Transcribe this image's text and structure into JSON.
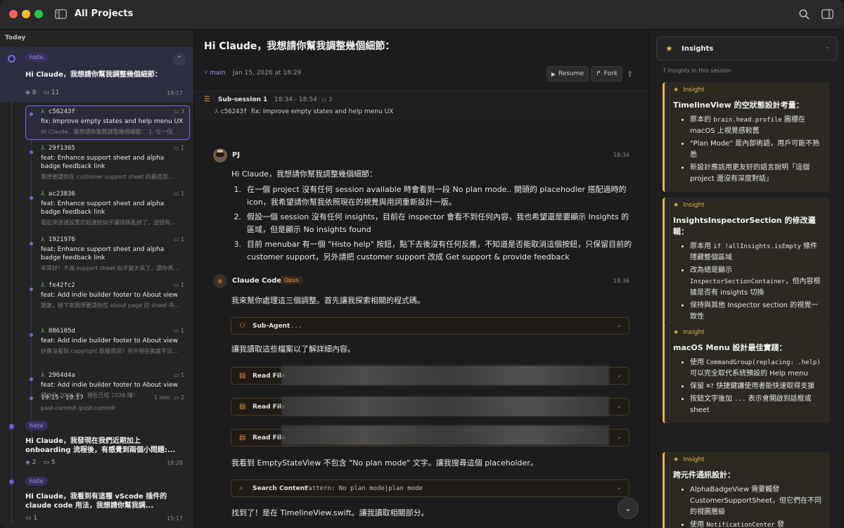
{
  "window": {
    "title": "All Projects"
  },
  "sidebar": {
    "section": "Today",
    "sessions": [
      {
        "tag": "histo",
        "title": "Hi Claude，我想請你幫我調整幾個細節：",
        "layers": "8",
        "comments": "11",
        "time": "19:17"
      },
      {
        "tag": "histo",
        "title": "Hi Claude，我發現在我們近期加上 onboarding 流程後，有感覺到兩個小問題:...",
        "layers": "2",
        "comments": "5",
        "time": "18:28"
      },
      {
        "tag": "histo",
        "title": "Hi Claude，我看到有這種 vScode 插件的 claude code 用法，我想請你幫我調...",
        "comments": "1",
        "time": "15:17"
      }
    ],
    "commits": [
      {
        "hash": "c56243f",
        "count": "3",
        "message": "fix: Improve empty states and help menu UX",
        "preview": "Hi Claude，我想請你幫我調整幾個細節： 1. 在一個..."
      },
      {
        "hash": "29f1365",
        "count": "1",
        "message": "feat: Enhance support sheet and alpha badge feedback link",
        "preview": "我想要請你在 customer support sheet 的最底部..."
      },
      {
        "hash": "ac23836",
        "count": "1",
        "message": "feat: Enhance support sheet and alpha badge feedback link",
        "preview": "看起來這邊設置的超連結似乎讓排版亂掉了，這個有..."
      },
      {
        "hash": "1921976",
        "count": "1",
        "message": "feat: Enhance support sheet and alpha badge feedback link",
        "preview": "非常好！不過 support sheet 似乎變太長了，請你再..."
      },
      {
        "hash": "fe42fc2",
        "count": "1",
        "message": "feat: Add indie builder footer to About view",
        "preview": "謝謝，接下來我想要請你在 about page 的 sheet 中..."
      },
      {
        "hash": "086105d",
        "count": "1",
        "message": "feat: Add indie builder footer to About view",
        "preview": "好像沒看到 copyright 版權資訊？另外現在高度不足..."
      },
      {
        "hash": "2964d4a",
        "count": "1",
        "message": "feat: Add indie builder footer to About view",
        "preview": "請改為 2026 年，現在已經 2026 囉！"
      }
    ],
    "post_commit": {
      "range": "19:15 - 19:17",
      "duration": "1 min",
      "count": "2",
      "label": "post-commit /post-commit"
    }
  },
  "main": {
    "title": "Hi Claude，我想請你幫我調整幾個細節：",
    "branch": "main",
    "date": "Jan 15, 2026 at 18:29",
    "resume_label": "Resume",
    "fork_label": "Fork",
    "subsession": {
      "label": "Sub-session 1",
      "range": "18:34 - 18:54",
      "count": "3",
      "hash": "c56243f",
      "message": "fix: Improve empty states and help menu UX"
    },
    "user": {
      "name": "PJ",
      "time": "18:34",
      "intro": "Hi Claude，我想請你幫我調整幾個細節：",
      "items": [
        {
          "num": "1.",
          "text": "在一個 project 沒有任何 session available 時會看到一段 No plan mode.. 開頭的 placehodler 搭配過時的 icon，我希望請你幫我依照現在的視覺與用詞重新設計一版。"
        },
        {
          "num": "2.",
          "text": "假設一個 session 沒有任何 insights，目前在 inspector 會看不到任何內容，我也希望還是要顯示 Insights 的區域，但是顯示 No insights found"
        },
        {
          "num": "3.",
          "text": "目前 menubar 有一個 \"Histo help\" 按鈕，點下去後沒有任何反應，不知道是否能取消這個按鈕，只保留目前的 customer support，另外請把 customer support 改成 Get support & provide feedback"
        }
      ]
    },
    "assistant": {
      "name": "Claude Code",
      "badge": "Opus",
      "time": "18:36",
      "line1": "我來幫你處理這三個調整。首先讓我探索相關的程式碼。",
      "subagent_label": "Sub-Agent",
      "subagent_value": "...",
      "line2": "讓我讀取這些檔案以了解詳細內容。",
      "read_label": "Read File",
      "line3": "我看到 EmptyStateView 不包含 \"No plan mode\" 文字。讓我搜尋這個 placeholder。",
      "search_label": "Search Content",
      "search_pattern": "Pattern: No plan mode|plan mode",
      "line4": "找到了！是在 TimelineView.swift。讓我讀取相關部分。"
    }
  },
  "inspector": {
    "title": "Insights",
    "summary": "7 insights in this session",
    "header_label": "Insight",
    "cards": [
      {
        "title": "TimelineView 的空狀態設計考量：",
        "bullets": [
          {
            "pre": "原本的 ",
            "code": "brain.head.profile",
            "post": " 圖標在 macOS 上視覺感較舊"
          },
          {
            "pre": "\"Plan Mode\" 是內部術語，用戶可能不熟悉",
            "code": "",
            "post": ""
          },
          {
            "pre": "新設計應該用更友好的語言說明「這個 project 還沒有深度對話」",
            "code": "",
            "post": ""
          }
        ]
      },
      {
        "title": "InsightsInspectorSection 的修改邏輯：",
        "bullets": [
          {
            "pre": "原本用 ",
            "code": "if !allInsights.isEmpty",
            "post": " 條件隱藏整個區域"
          },
          {
            "pre": "改為總是顯示 ",
            "code": "InspectorSectionContainer",
            "post": "，但內容根據是否有 insights 切換"
          },
          {
            "pre": "保持與其他 Inspector section 的視覺一致性",
            "code": "",
            "post": ""
          }
        ]
      },
      {
        "title": "macOS Menu 設計最佳實踐：",
        "bullets": [
          {
            "pre": "使用 ",
            "code": "CommandGroup(replacing: .help)",
            "post": " 可以完全取代系統預設的 Help menu"
          },
          {
            "pre": "保留 ",
            "code": "⌘?",
            "post": " 快捷鍵讓使用者能快速取得支援"
          },
          {
            "pre": "按鈕文字後加 ",
            "code": "...",
            "post": " 表示會開啟到話框或 sheet"
          }
        ]
      },
      {
        "title": "跨元件通訊設計：",
        "bullets": [
          {
            "pre": "AlphaBadgeView 需要觸發 CustomerSupportSheet，但它們在不同的視圖層級",
            "code": "",
            "post": ""
          },
          {
            "pre": "使用 ",
            "code": "NotificationCenter",
            "post": " 發"
          }
        ]
      }
    ]
  },
  "colors": {
    "accent": "#7b6cf0",
    "insight": "#e0b84a",
    "branch": "#a08cf0",
    "commit_green": "#5cc26b",
    "tool_orange": "#e88a3a"
  }
}
